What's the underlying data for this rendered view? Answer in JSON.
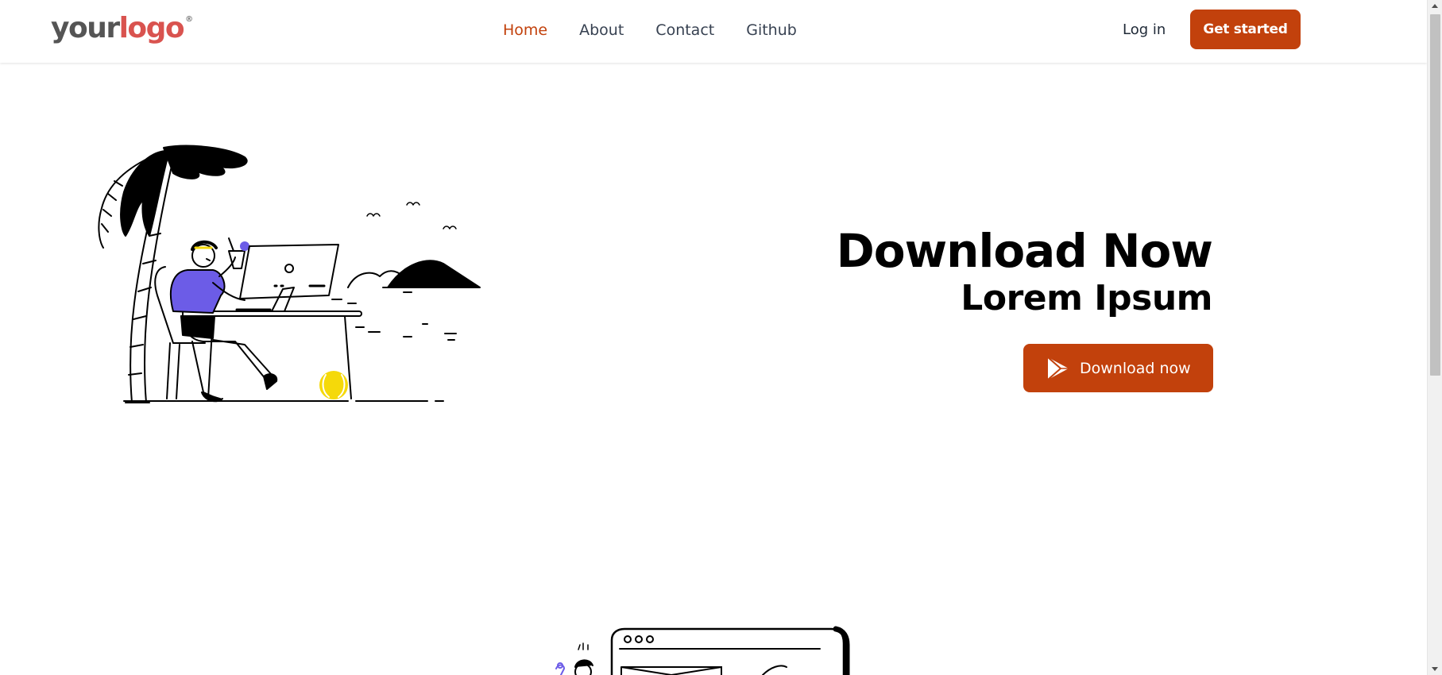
{
  "header": {
    "logo": {
      "word1": "your",
      "word2": "logo",
      "mark": "®"
    },
    "nav": [
      {
        "label": "Home",
        "active": true
      },
      {
        "label": "About",
        "active": false
      },
      {
        "label": "Contact",
        "active": false
      },
      {
        "label": "Github",
        "active": false
      }
    ],
    "login_label": "Log in",
    "cta_label": "Get started"
  },
  "hero": {
    "title": "Download Now",
    "subtitle": "Lorem Ipsum",
    "button_label": "Download now",
    "button_icon": "play-store-icon",
    "illustration": "person-working-on-beach-illustration"
  },
  "second_section": {
    "illustration": "person-with-browser-window-illustration"
  },
  "colors": {
    "accent": "#c2410c",
    "logo_grey": "#555555",
    "logo_red": "#d9534f",
    "nav_text": "#374151",
    "figure_purple": "#6c5ce7",
    "ball_yellow": "#f5d90a"
  }
}
